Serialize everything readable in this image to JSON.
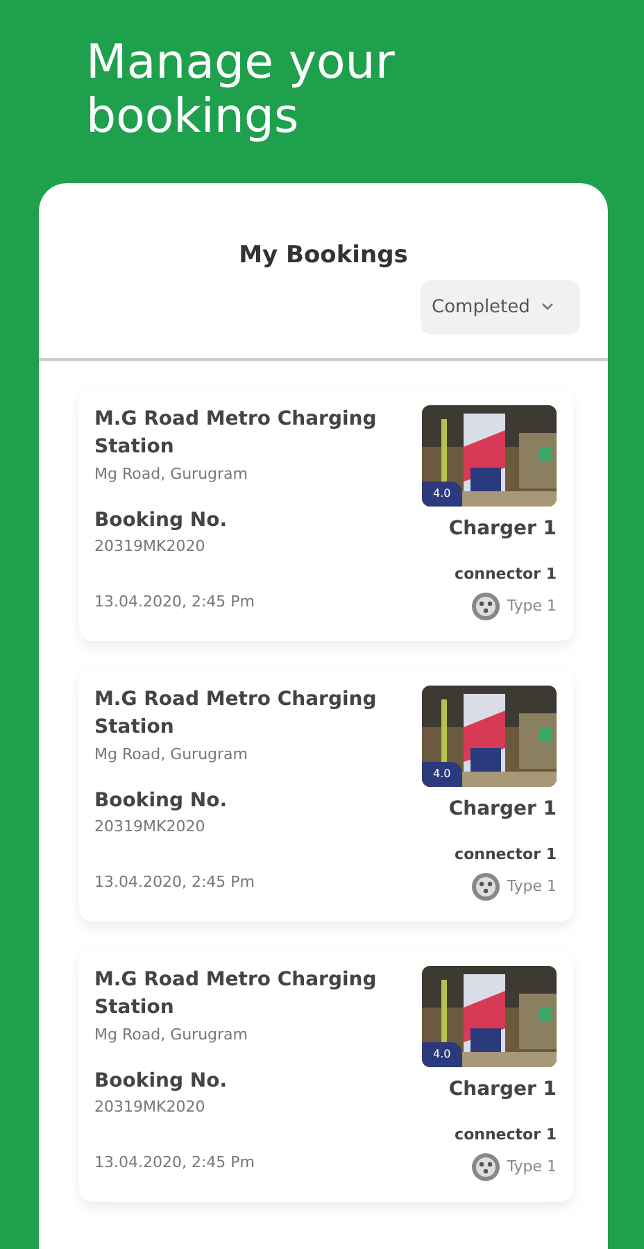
{
  "header": {
    "title": "Manage your bookings"
  },
  "panel": {
    "title": "My Bookings",
    "filter": "Completed"
  },
  "bookings": [
    {
      "station": "M.G Road Metro Charging Station",
      "address": "Mg Road, Gurugram",
      "booking_label": "Booking No.",
      "booking_no": "20319MK2020",
      "datetime": "13.04.2020, 2:45 Pm",
      "rating": "4.0",
      "charger": "Charger 1",
      "connector": "connector 1",
      "type": "Type 1"
    },
    {
      "station": "M.G Road Metro Charging Station",
      "address": "Mg Road, Gurugram",
      "booking_label": "Booking No.",
      "booking_no": "20319MK2020",
      "datetime": "13.04.2020, 2:45 Pm",
      "rating": "4.0",
      "charger": "Charger 1",
      "connector": "connector 1",
      "type": "Type 1"
    },
    {
      "station": "M.G Road Metro Charging Station",
      "address": "Mg Road, Gurugram",
      "booking_label": "Booking No.",
      "booking_no": "20319MK2020",
      "datetime": "13.04.2020, 2:45 Pm",
      "rating": "4.0",
      "charger": "Charger 1",
      "connector": "connector 1",
      "type": "Type 1"
    }
  ]
}
